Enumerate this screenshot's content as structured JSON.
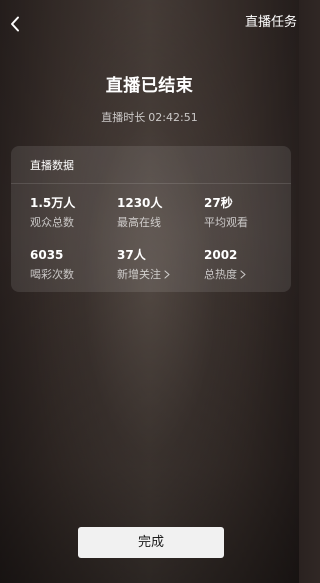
{
  "header": {
    "back_icon": "chevron-left-icon",
    "task_link": "直播任务"
  },
  "summary": {
    "title": "直播已结束",
    "duration_label": "直播时长",
    "duration_value": "02:42:51"
  },
  "stats_card": {
    "title": "直播数据",
    "items": [
      {
        "value": "1.5万人",
        "label": "观众总数"
      },
      {
        "value": "1230人",
        "label": "最高在线"
      },
      {
        "value": "27秒",
        "label": "平均观看"
      },
      {
        "value": "6035",
        "label": "喝彩次数"
      },
      {
        "value": "37人",
        "label": "新增关注",
        "has_chevron": true
      },
      {
        "value": "2002",
        "label": "总热度",
        "has_chevron": true
      }
    ]
  },
  "footer": {
    "done_label": "完成"
  },
  "colors": {
    "background": "#3a302c",
    "card": "rgba(255,255,255,0.10)",
    "button": "#f1f1f1",
    "button_text": "#1b1b1b"
  }
}
